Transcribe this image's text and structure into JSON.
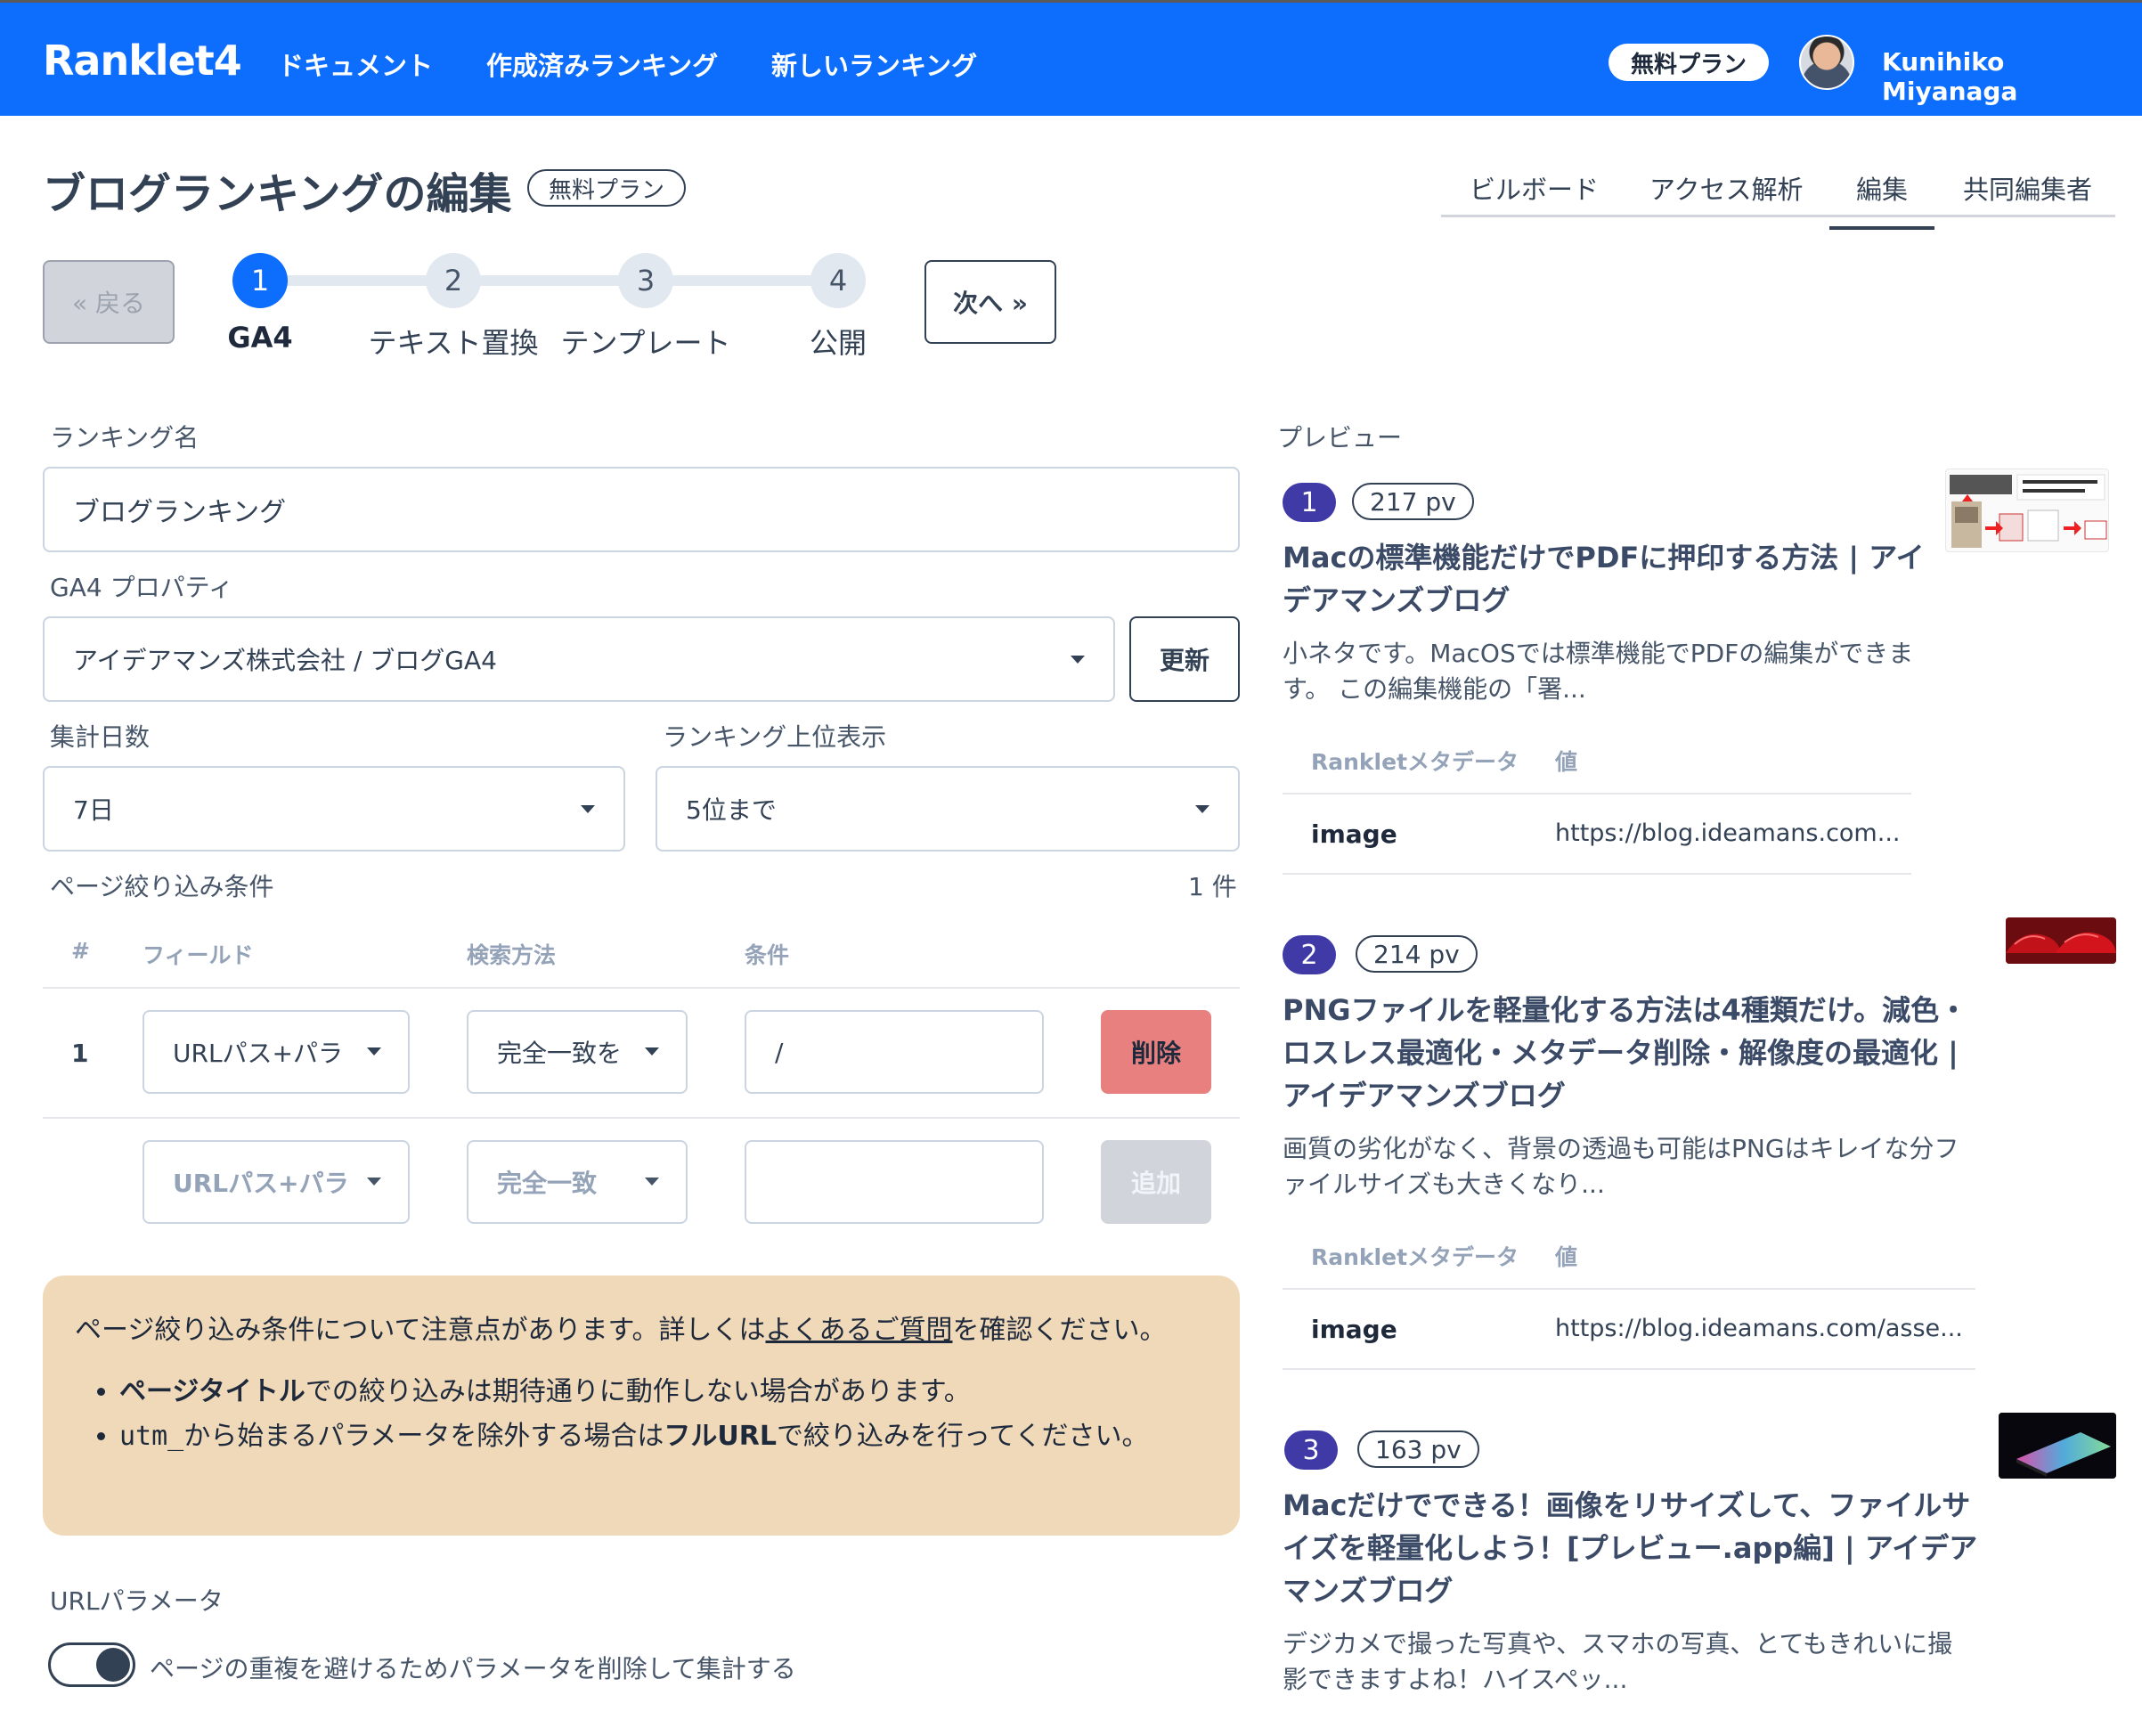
{
  "navbar": {
    "brand": "Ranklet4",
    "links": [
      "ドキュメント",
      "作成済みランキング",
      "新しいランキング"
    ],
    "plan": "無料プラン",
    "user_name": "Kunihiko Miyanaga"
  },
  "header": {
    "title": "ブログランキングの編集",
    "plan_badge": "無料プラン",
    "tabs": [
      "ビルボード",
      "アクセス解析",
      "編集",
      "共同編集者"
    ],
    "active_tab": "編集"
  },
  "stepper": {
    "back": "« 戻る",
    "next": "次へ »",
    "steps": [
      {
        "num": "1",
        "label": "GA4"
      },
      {
        "num": "2",
        "label": "テキスト置換"
      },
      {
        "num": "3",
        "label": "テンプレート"
      },
      {
        "num": "4",
        "label": "公開"
      }
    ]
  },
  "form": {
    "ranking_name_label": "ランキング名",
    "ranking_name_value": "ブログランキング",
    "ga4_label": "GA4 プロパティ",
    "ga4_value": "アイデアマンズ株式会社 / ブログGA4",
    "update_button": "更新",
    "days_label": "集計日数",
    "days_value": "7日",
    "top_label": "ランキング上位表示",
    "top_value": "5位まで",
    "filter_label": "ページ絞り込み条件",
    "filter_count": "1 件",
    "columns": [
      "#",
      "フィールド",
      "検索方法",
      "条件"
    ],
    "rows": [
      {
        "num": "1",
        "field": "URLパス+パラ",
        "method": "完全一致を",
        "condition": "/",
        "action": "削除"
      }
    ],
    "new_row": {
      "field": "URLパス+パラ",
      "method": "完全一致",
      "condition": "",
      "action": "追加"
    },
    "notice": {
      "text_before": "ページ絞り込み条件について注意点があります。詳しくは",
      "link": "よくあるご質問",
      "text_after": "を確認ください。",
      "item1_bold": "ページタイトル",
      "item1_rest": "での絞り込みは期待通りに動作しない場合があります。",
      "item2_code": "utm_",
      "item2_mid": "から始まるパラメータを除外する場合は",
      "item2_bold": "フルURL",
      "item2_rest": "で絞り込みを行ってください。"
    },
    "url_param_label": "URLパラメータ",
    "url_param_toggle": "ページの重複を避けるためパラメータを削除して集計する"
  },
  "preview": {
    "label": "プレビュー",
    "meta_header_key": "Rankletメタデータ",
    "meta_header_val": "値",
    "items": [
      {
        "rank": "1",
        "pv": "217 pv",
        "title_lines": [
          "Macの標準機能だけでPDFに押印する方法 | アイ",
          "デアマンズブログ"
        ],
        "desc_lines": [
          "小ネタです。MacOSでは標準機能でPDFの編集ができま",
          "す。 この編集機能の「署..."
        ],
        "meta_key": "image",
        "meta_val": "https://blog.ideamans.com..."
      },
      {
        "rank": "2",
        "pv": "214 pv",
        "title_lines": [
          "PNGファイルを軽量化する方法は4種類だけ。減色・",
          "ロスレス最適化・メタデータ削除・解像度の最適化 |",
          "アイデアマンズブログ"
        ],
        "desc_lines": [
          "画質の劣化がなく、背景の透過も可能はPNGはキレイな分フ",
          "ァイルサイズも大きくなり..."
        ],
        "meta_key": "image",
        "meta_val": "https://blog.ideamans.com/asse..."
      },
      {
        "rank": "3",
        "pv": "163 pv",
        "title_lines": [
          "Macだけでできる！画像をリサイズして、ファイルサ",
          "イズを軽量化しよう！[プレビュー.app編] | アイデア",
          "マンズブログ"
        ],
        "desc_lines": [
          "デジカメで撮った写真や、スマホの写真、とてもきれいに撮",
          "影できますよね！ハイスペッ..."
        ]
      }
    ]
  },
  "colors": {
    "primary": "#0d6efd",
    "rank_badge": "#3f3aa6",
    "danger": "#e88080",
    "notice_bg": "#f0d9b8"
  }
}
